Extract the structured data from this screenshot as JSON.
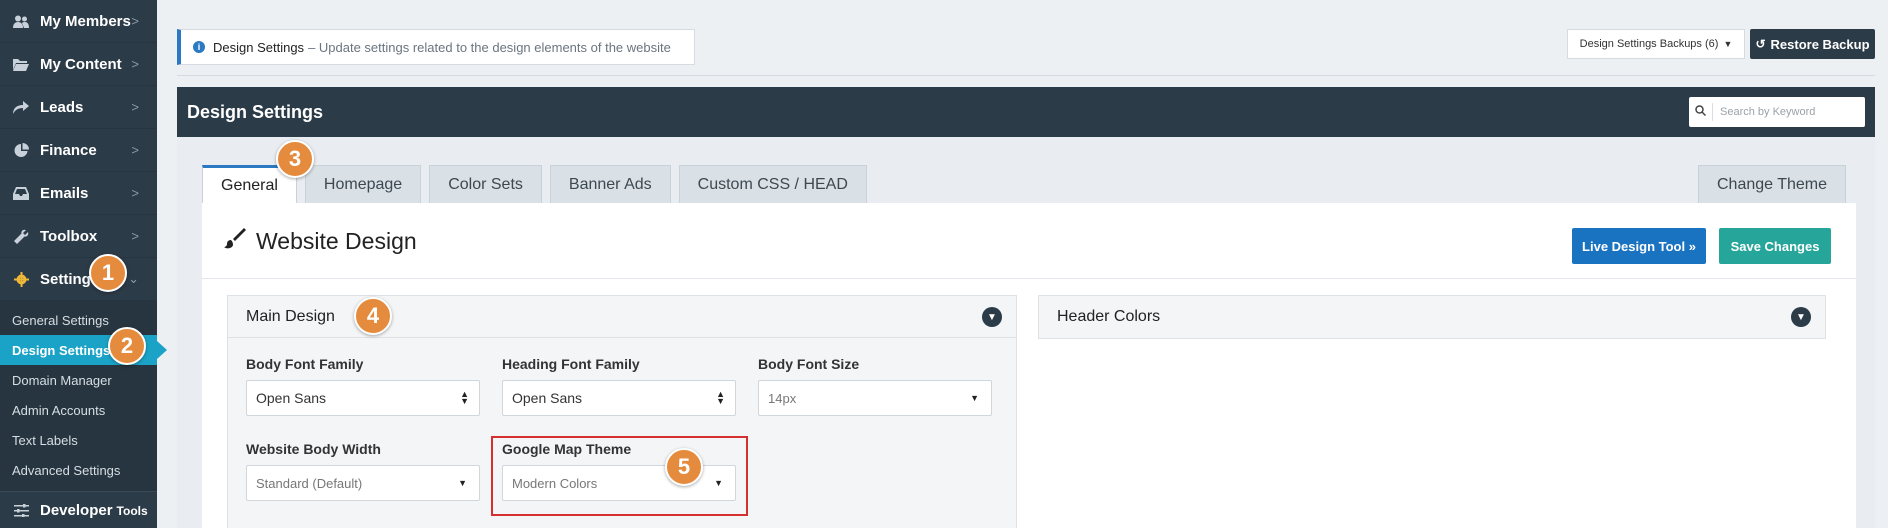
{
  "sidebar": {
    "items": [
      {
        "label": "My Members"
      },
      {
        "label": "My Content"
      },
      {
        "label": "Leads"
      },
      {
        "label": "Finance"
      },
      {
        "label": "Emails"
      },
      {
        "label": "Toolbox"
      },
      {
        "label": "Settings"
      }
    ],
    "sub_items": [
      {
        "label": "General Settings"
      },
      {
        "label": "Design Settings"
      },
      {
        "label": "Domain Manager"
      },
      {
        "label": "Admin Accounts"
      },
      {
        "label": "Text Labels"
      },
      {
        "label": "Advanced Settings"
      }
    ],
    "developer": {
      "label": "Developer",
      "suffix": "Tools"
    }
  },
  "badges": [
    "1",
    "2",
    "3",
    "4",
    "5"
  ],
  "info": {
    "title": "Design Settings",
    "description": "– Update settings related to the design elements of the website"
  },
  "toolbar": {
    "backups_label": "Design Settings Backups (6)",
    "restore_label": "Restore Backup"
  },
  "panel": {
    "title": "Design Settings",
    "search_placeholder": "Search by Keyword"
  },
  "tabs": [
    {
      "label": "General"
    },
    {
      "label": "Homepage"
    },
    {
      "label": "Color Sets"
    },
    {
      "label": "Banner Ads"
    },
    {
      "label": "Custom CSS / HEAD"
    }
  ],
  "change_theme_label": "Change Theme",
  "section": {
    "title": "Website Design",
    "live_label": "Live Design Tool »",
    "save_label": "Save Changes"
  },
  "main_design": {
    "title": "Main Design",
    "fields": {
      "body_font": {
        "label": "Body Font Family",
        "value": "Open Sans"
      },
      "heading_font": {
        "label": "Heading Font Family",
        "value": "Open Sans"
      },
      "body_size": {
        "label": "Body Font Size",
        "value": "14px"
      },
      "body_width": {
        "label": "Website Body Width",
        "value": "Standard (Default)"
      },
      "map_theme": {
        "label": "Google Map Theme",
        "value": "Modern Colors"
      }
    }
  },
  "header_colors": {
    "title": "Header Colors"
  },
  "colors": {
    "sidebar_bg": "#2c3b48",
    "selected_blue": "#1aa3c6",
    "badge_orange": "#e58b3d",
    "live_blue": "#1a73c1",
    "save_teal": "#26a69a",
    "highlight_red": "#d62f2f"
  }
}
